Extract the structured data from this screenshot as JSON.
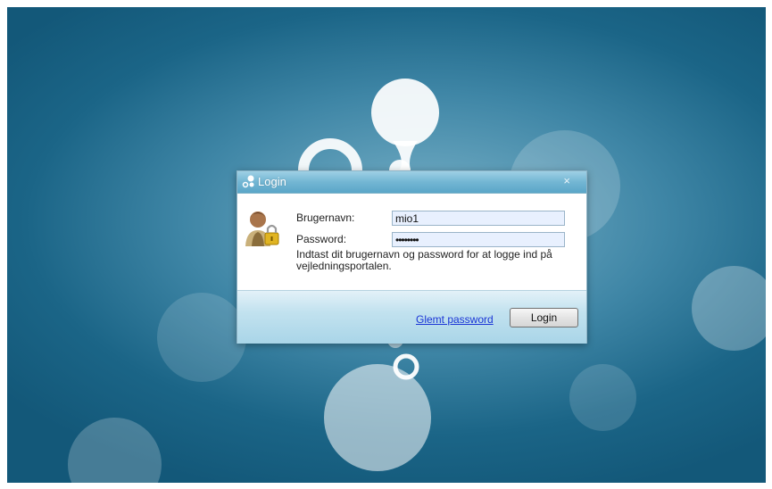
{
  "dialog": {
    "title": "Login",
    "close_symbol": "×",
    "username_label": "Brugernavn:",
    "username_value": "mio1",
    "password_label": "Password:",
    "password_value": "mio12345",
    "hint": "Indtast dit brugernavn og password for at logge ind på vejledningsportalen.",
    "forgot_link": "Glemt password",
    "login_button": "Login"
  },
  "icons": {
    "title_icon": "app-logo-icon",
    "user_icon": "user-lock-icon"
  },
  "colors": {
    "titlebar": "#73b6d3",
    "desktop": "#1b6587",
    "link": "#1a35d6"
  }
}
